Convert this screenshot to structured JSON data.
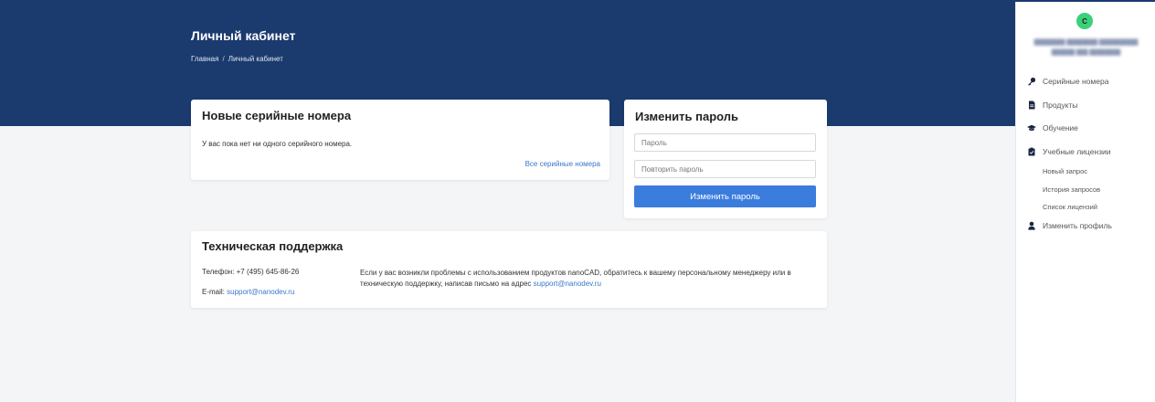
{
  "header": {
    "title": "Личный кабинет",
    "breadcrumb": [
      "Главная",
      "/",
      "Личный кабинет"
    ]
  },
  "serials_card": {
    "title": "Новые серийные номера",
    "empty_text": "У вас пока нет ни одного серийного номера.",
    "all_link": "Все серийные номера"
  },
  "password_card": {
    "title": "Изменить пароль",
    "password_placeholder": "Пароль",
    "repeat_placeholder": "Повторить пароль",
    "button_label": "Изменить пароль"
  },
  "support_card": {
    "title": "Техническая поддержка",
    "phone_label": "Телефон: +7 (495) 645-86-26",
    "email_label": "E-mail:",
    "email_link": "support@nanodev.ru",
    "text": "Если у вас возникли проблемы с использованием продуктов nanoCAD, обратитесь к вашему персональному менеджеру или в техническую поддержку, написав письмо на адрес",
    "text_link": "support@nanodev.ru"
  },
  "sidebar": {
    "avatar_letter": "С",
    "nav": [
      {
        "label": "Серийные номера",
        "icon": "key-icon"
      },
      {
        "label": "Продукты",
        "icon": "document-icon"
      },
      {
        "label": "Обучение",
        "icon": "graduation-cap-icon"
      },
      {
        "label": "Учебные лицензии",
        "icon": "clipboard-icon"
      }
    ],
    "sub_items": [
      "Новый запрос",
      "История запросов",
      "Список лицензий"
    ],
    "profile": {
      "label": "Изменить профиль",
      "icon": "user-icon"
    }
  },
  "colors": {
    "header_bg": "#1b3a6e",
    "accent": "#3b7ddd",
    "link": "#3b78c9",
    "avatar": "#3ad17a"
  }
}
